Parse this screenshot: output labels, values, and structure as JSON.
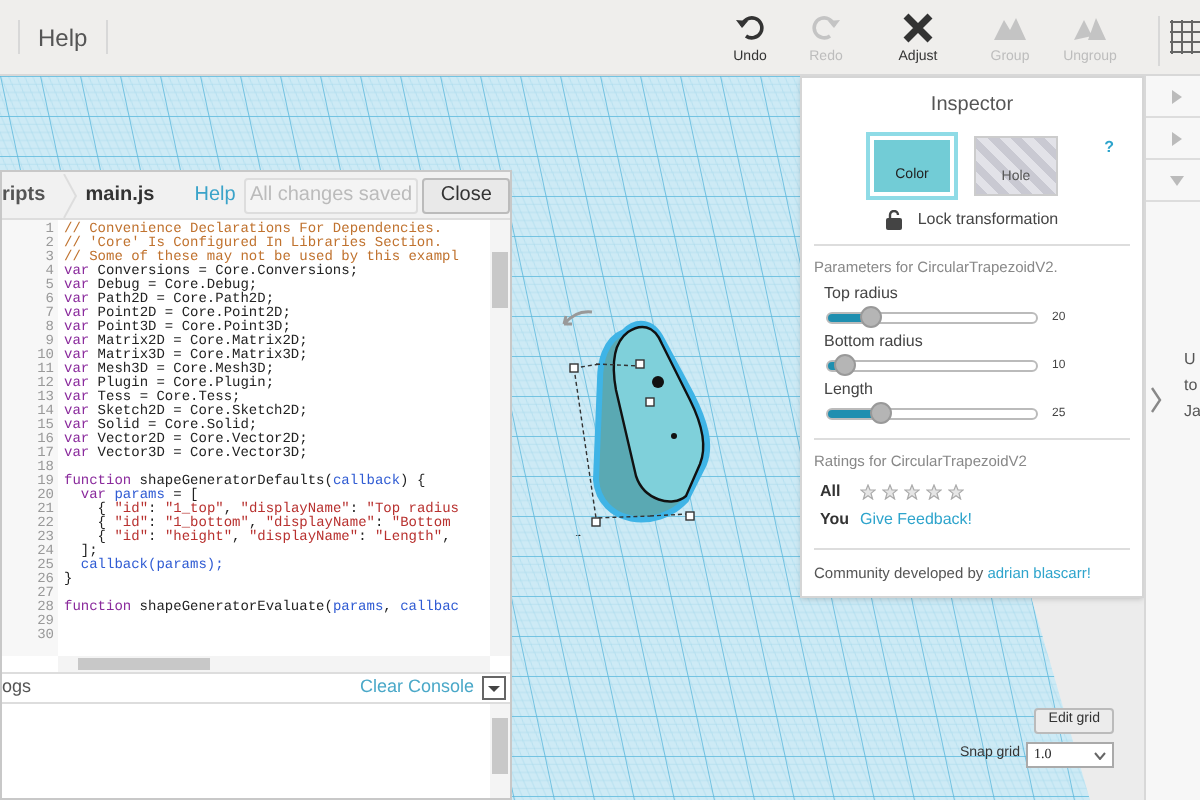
{
  "toolbar": {
    "menu": [
      {
        "label": "Help"
      }
    ],
    "tools": [
      {
        "kind": "undo",
        "label": "Undo",
        "disabled": false
      },
      {
        "kind": "redo",
        "label": "Redo",
        "disabled": true
      },
      {
        "kind": "adjust",
        "label": "Adjust",
        "disabled": false
      },
      {
        "kind": "group",
        "label": "Group",
        "disabled": true
      },
      {
        "kind": "ungroup",
        "label": "Ungroup",
        "disabled": true
      }
    ]
  },
  "editor": {
    "breadcrumb": "ripts",
    "file": "main.js",
    "help": "Help",
    "save_status": {
      "label": "All changes saved",
      "disabled": true
    },
    "close": "Close",
    "lines": [
      {
        "number": "1",
        "tokens": [
          {
            "kind": "comment",
            "text": "// Convenience Declarations For Dependencies."
          }
        ]
      },
      {
        "number": "2",
        "tokens": [
          {
            "kind": "comment",
            "text": "// 'Core' Is Configured In Libraries Section."
          }
        ]
      },
      {
        "number": "3",
        "tokens": [
          {
            "kind": "comment",
            "text": "// Some of these may not be used by this exampl"
          }
        ]
      },
      {
        "number": "4",
        "tokens": [
          {
            "kind": "keyword",
            "text": "var"
          },
          {
            "kind": "plain",
            "text": " Conversions = Core.Conversions;"
          }
        ]
      },
      {
        "number": "5",
        "tokens": [
          {
            "kind": "keyword",
            "text": "var"
          },
          {
            "kind": "plain",
            "text": " Debug = Core.Debug;"
          }
        ]
      },
      {
        "number": "6",
        "tokens": [
          {
            "kind": "keyword",
            "text": "var"
          },
          {
            "kind": "plain",
            "text": " Path2D = Core.Path2D;"
          }
        ]
      },
      {
        "number": "7",
        "tokens": [
          {
            "kind": "keyword",
            "text": "var"
          },
          {
            "kind": "plain",
            "text": " Point2D = Core.Point2D;"
          }
        ]
      },
      {
        "number": "8",
        "tokens": [
          {
            "kind": "keyword",
            "text": "var"
          },
          {
            "kind": "plain",
            "text": " Point3D = Core.Point3D;"
          }
        ]
      },
      {
        "number": "9",
        "tokens": [
          {
            "kind": "keyword",
            "text": "var"
          },
          {
            "kind": "plain",
            "text": " Matrix2D = Core.Matrix2D;"
          }
        ]
      },
      {
        "number": "10",
        "tokens": [
          {
            "kind": "keyword",
            "text": "var"
          },
          {
            "kind": "plain",
            "text": " Matrix3D = Core.Matrix3D;"
          }
        ]
      },
      {
        "number": "11",
        "tokens": [
          {
            "kind": "keyword",
            "text": "var"
          },
          {
            "kind": "plain",
            "text": " Mesh3D = Core.Mesh3D;"
          }
        ]
      },
      {
        "number": "12",
        "tokens": [
          {
            "kind": "keyword",
            "text": "var"
          },
          {
            "kind": "plain",
            "text": " Plugin = Core.Plugin;"
          }
        ]
      },
      {
        "number": "13",
        "tokens": [
          {
            "kind": "keyword",
            "text": "var"
          },
          {
            "kind": "plain",
            "text": " Tess = Core.Tess;"
          }
        ]
      },
      {
        "number": "14",
        "tokens": [
          {
            "kind": "keyword",
            "text": "var"
          },
          {
            "kind": "plain",
            "text": " Sketch2D = Core.Sketch2D;"
          }
        ]
      },
      {
        "number": "15",
        "tokens": [
          {
            "kind": "keyword",
            "text": "var"
          },
          {
            "kind": "plain",
            "text": " Solid = Core.Solid;"
          }
        ]
      },
      {
        "number": "16",
        "tokens": [
          {
            "kind": "keyword",
            "text": "var"
          },
          {
            "kind": "plain",
            "text": " Vector2D = Core.Vector2D;"
          }
        ]
      },
      {
        "number": "17",
        "tokens": [
          {
            "kind": "keyword",
            "text": "var"
          },
          {
            "kind": "plain",
            "text": " Vector3D = Core.Vector3D;"
          }
        ]
      },
      {
        "number": "18"
      },
      {
        "number": "19",
        "tokens": [
          {
            "kind": "keyword",
            "text": "function"
          },
          {
            "kind": "plain",
            "text": " shapeGeneratorDefaults("
          },
          {
            "kind": "variable",
            "text": "callback"
          },
          {
            "kind": "plain",
            "text": ") {"
          }
        ]
      },
      {
        "number": "20",
        "tokens": [
          {
            "kind": "keyword",
            "text": "  var"
          },
          {
            "kind": "variable",
            "text": " params"
          },
          {
            "kind": "plain",
            "text": " = ["
          }
        ]
      },
      {
        "number": "21",
        "tokens": [
          {
            "kind": "plain",
            "text": "    { "
          },
          {
            "kind": "string",
            "text": "\"id\""
          },
          {
            "kind": "plain",
            "text": ": "
          },
          {
            "kind": "string",
            "text": "\"1_top\""
          },
          {
            "kind": "plain",
            "text": ", "
          },
          {
            "kind": "string",
            "text": "\"displayName\""
          },
          {
            "kind": "plain",
            "text": ": "
          },
          {
            "kind": "string",
            "text": "\"Top radius"
          }
        ]
      },
      {
        "number": "22",
        "tokens": [
          {
            "kind": "plain",
            "text": "    { "
          },
          {
            "kind": "string",
            "text": "\"id\""
          },
          {
            "kind": "plain",
            "text": ": "
          },
          {
            "kind": "string",
            "text": "\"1_bottom\""
          },
          {
            "kind": "plain",
            "text": ", "
          },
          {
            "kind": "string",
            "text": "\"displayName\""
          },
          {
            "kind": "plain",
            "text": ": "
          },
          {
            "kind": "string",
            "text": "\"Bottom"
          }
        ]
      },
      {
        "number": "23",
        "tokens": [
          {
            "kind": "plain",
            "text": "    { "
          },
          {
            "kind": "string",
            "text": "\"id\""
          },
          {
            "kind": "plain",
            "text": ": "
          },
          {
            "kind": "string",
            "text": "\"height\""
          },
          {
            "kind": "plain",
            "text": ", "
          },
          {
            "kind": "string",
            "text": "\"displayName\""
          },
          {
            "kind": "plain",
            "text": ": "
          },
          {
            "kind": "string",
            "text": "\"Length\""
          },
          {
            "kind": "plain",
            "text": ","
          }
        ]
      },
      {
        "number": "24",
        "tokens": [
          {
            "kind": "plain",
            "text": "  ];"
          }
        ]
      },
      {
        "number": "25",
        "tokens": [
          {
            "kind": "variable",
            "text": "  callback(params);"
          }
        ]
      },
      {
        "number": "26",
        "tokens": [
          {
            "kind": "plain",
            "text": "}"
          }
        ]
      },
      {
        "number": "27"
      },
      {
        "number": "28",
        "tokens": [
          {
            "kind": "keyword",
            "text": "function"
          },
          {
            "kind": "plain",
            "text": " shapeGeneratorEvaluate("
          },
          {
            "kind": "variable",
            "text": "params"
          },
          {
            "kind": "plain",
            "text": ", "
          },
          {
            "kind": "variable",
            "text": "callbac"
          }
        ]
      },
      {
        "number": "29"
      },
      {
        "number": "30"
      }
    ],
    "console": {
      "title": "ogs",
      "clear": "Clear Console"
    }
  },
  "inspector": {
    "title": "Inspector",
    "help": "?",
    "swatches": [
      {
        "kind": "solid",
        "label": "Color",
        "selected": true
      },
      {
        "kind": "hole",
        "label": "Hole",
        "selected": false
      }
    ],
    "lock": {
      "label": "Lock transformation"
    },
    "params_title": "Parameters for CircularTrapezoidV2.",
    "params": [
      {
        "name": "Top radius",
        "level": 0.2,
        "reading": "20"
      },
      {
        "name": "Bottom radius",
        "level": 0.08,
        "reading": "10"
      },
      {
        "name": "Length",
        "level": 0.25,
        "reading": "25"
      }
    ],
    "ratings_title": "Ratings for CircularTrapezoidV2",
    "ratings": {
      "all_label": "All",
      "stars": 0,
      "you_label": "You",
      "feedback": "Give Feedback!"
    },
    "credit": {
      "text": "Community developed by",
      "author": "adrian blascarr!"
    }
  },
  "side_panel": {
    "sections": [
      {
        "expanded": false
      },
      {
        "expanded": false
      },
      {
        "expanded": true
      }
    ],
    "text_lines": [
      "U",
      "to",
      "Ja"
    ]
  },
  "grid": {
    "edit": "Edit grid",
    "snap_label": "Snap grid",
    "snap_value": "1.0"
  }
}
